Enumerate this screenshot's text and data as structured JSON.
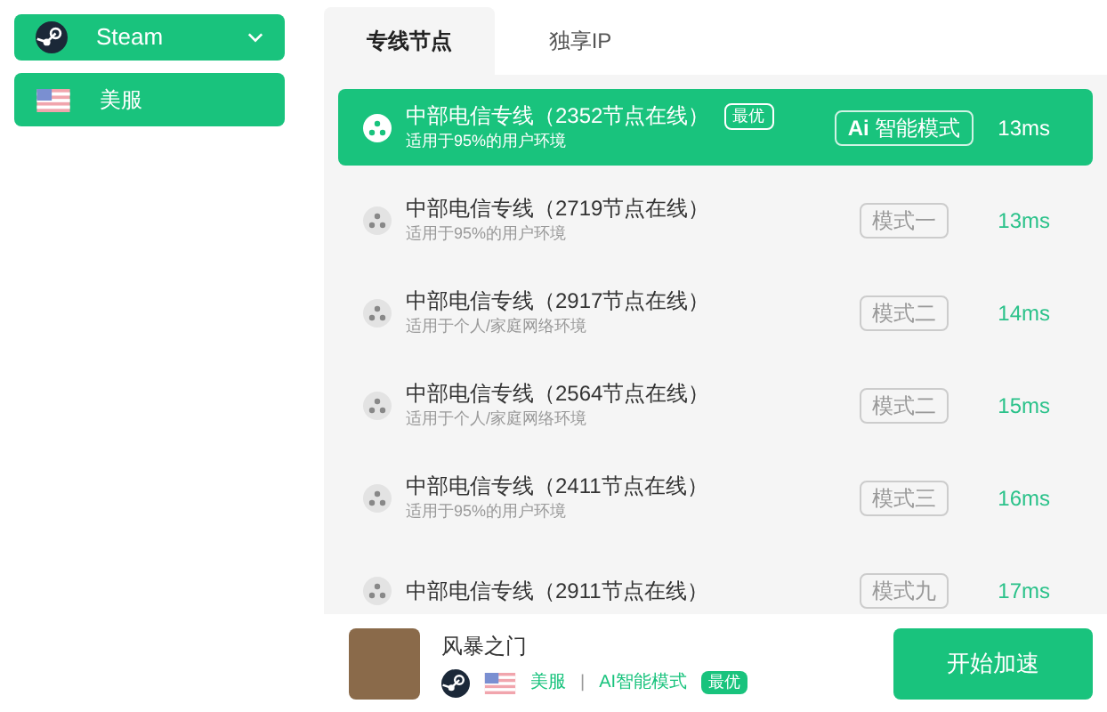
{
  "sidebar": {
    "platform": {
      "label": "Steam",
      "expanded": false
    },
    "region": {
      "label": "美服"
    }
  },
  "tabs": [
    {
      "label": "专线节点",
      "selected": true
    },
    {
      "label": "独享IP",
      "selected": false
    }
  ],
  "nodes": [
    {
      "title": "中部电信专线（2352节点在线）",
      "subtitle": "适用于95%的用户环境",
      "badge": "最优",
      "mode": "**Ai** 智能模式",
      "latency": "13ms",
      "selected": true
    },
    {
      "title": "中部电信专线（2719节点在线）",
      "subtitle": "适用于95%的用户环境",
      "mode": "模式一",
      "latency": "13ms",
      "selected": false
    },
    {
      "title": "中部电信专线（2917节点在线）",
      "subtitle": "适用于个人/家庭网络环境",
      "mode": "模式二",
      "latency": "14ms",
      "selected": false
    },
    {
      "title": "中部电信专线（2564节点在线）",
      "subtitle": "适用于个人/家庭网络环境",
      "mode": "模式二",
      "latency": "15ms",
      "selected": false
    },
    {
      "title": "中部电信专线（2411节点在线）",
      "subtitle": "适用于95%的用户环境",
      "mode": "模式三",
      "latency": "16ms",
      "selected": false
    },
    {
      "title": "中部电信专线（2911节点在线）",
      "mode": "模式九",
      "latency": "17ms",
      "selected": false
    }
  ],
  "footer": {
    "game": "风暴之门",
    "region": "美服",
    "separator": "|",
    "mode": "AI智能模式",
    "badge": "最优",
    "start_button": "开始加速"
  }
}
